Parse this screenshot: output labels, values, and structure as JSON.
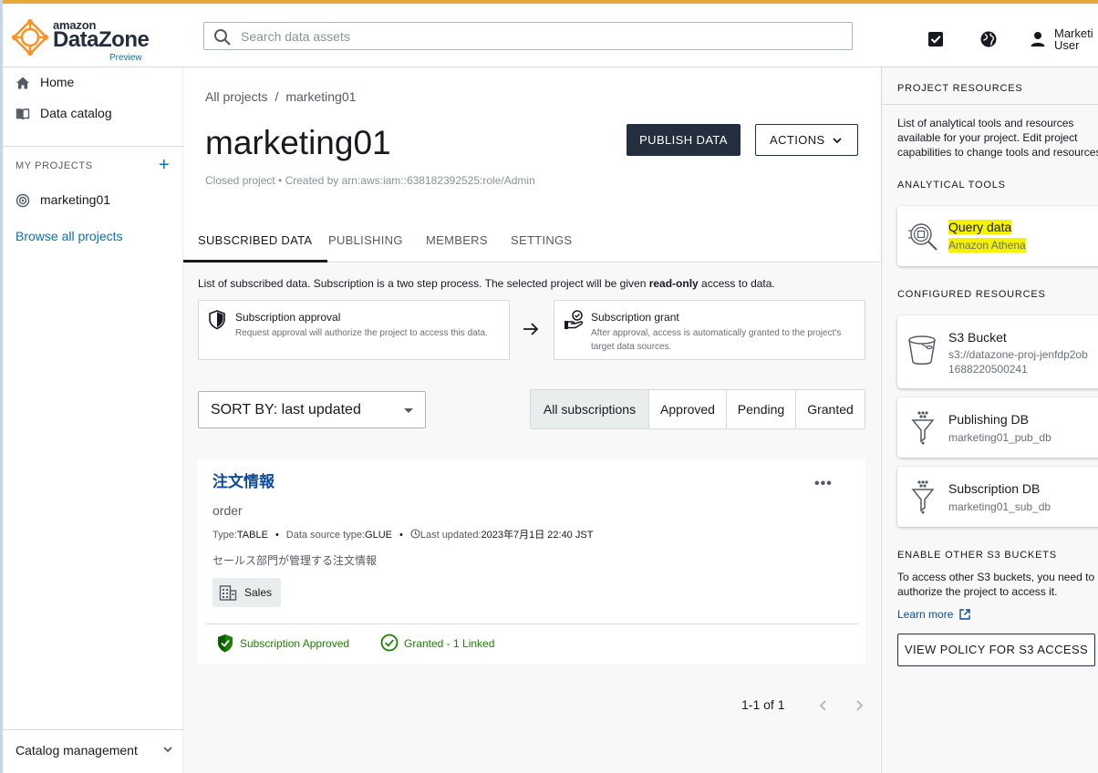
{
  "brand": {
    "amazon": "amazon",
    "name": "DataZone",
    "tag": "Preview",
    "accent_color": "#e8a93b"
  },
  "search": {
    "placeholder": "Search data assets"
  },
  "header": {
    "icons": [
      "checkbox-icon",
      "globe-icon",
      "user-icon"
    ],
    "user_line1": "Marketi",
    "user_line2": "User"
  },
  "sidebar": {
    "home": "Home",
    "catalog": "Data catalog",
    "section": "MY PROJECTS",
    "add": "+",
    "project": "marketing01",
    "browse": "Browse all projects",
    "catalog_management": "Catalog management"
  },
  "main": {
    "breadcrumb": {
      "root": "All projects",
      "sep": "/",
      "current": "marketing01"
    },
    "title": "marketing01",
    "subtitle": "Closed project • Created by arn:aws:iam::638182392525:role/Admin",
    "publish_button": "PUBLISH DATA",
    "actions_button": "ACTIONS",
    "tabs": [
      "SUBSCRIBED DATA",
      "PUBLISHING",
      "MEMBERS",
      "SETTINGS"
    ],
    "description_pre": "List of subscribed data. Subscription is a two step process. The selected project will be given ",
    "description_bold": "read-only",
    "description_post": " access to data.",
    "steps": [
      {
        "title": "Subscription approval",
        "desc": "Request approval will authorize the project to access this data."
      },
      {
        "title": "Subscription grant",
        "desc": "After approval, access is automatically granted to the project's target data sources."
      }
    ],
    "sort_label": "SORT BY: last updated",
    "filters": [
      "All subscriptions",
      "Approved",
      "Pending",
      "Granted"
    ],
    "asset": {
      "title": "注文情報",
      "name": "order",
      "type_label": "Type:",
      "type_value": "TABLE",
      "source_label": "Data source type:",
      "source_value": "GLUE",
      "updated_label": "Last updated:",
      "updated_value": "2023年7月1日 22:40 JST",
      "description": "セールス部門が管理する注文情報",
      "glossary_term": "Sales",
      "status_approved": "Subscription Approved",
      "status_granted": "Granted - 1 Linked"
    },
    "pagination": "1-1 of 1"
  },
  "resources": {
    "heading": "PROJECT RESOURCES",
    "intro": "List of analytical tools and resources available for your project. Edit project capabilities to change tools and resources.",
    "tools_heading": "ANALYTICAL TOOLS",
    "tool": {
      "title": "Query data",
      "subtitle": "Amazon Athena"
    },
    "configured_heading": "CONFIGURED RESOURCES",
    "s3": {
      "title": "S3 Bucket",
      "line1": "s3://datazone-proj-jenfdp2ob",
      "line2": "1688220500241"
    },
    "pub_db": {
      "title": "Publishing DB",
      "subtitle": "marketing01_pub_db"
    },
    "sub_db": {
      "title": "Subscription DB",
      "subtitle": "marketing01_sub_db"
    },
    "enable_heading": "ENABLE OTHER S3 BUCKETS",
    "enable_text": "To access other S3 buckets, you need to authorize the project to access it.",
    "learn_more": "Learn more",
    "policy_button": "VIEW POLICY FOR S3 ACCESS"
  }
}
